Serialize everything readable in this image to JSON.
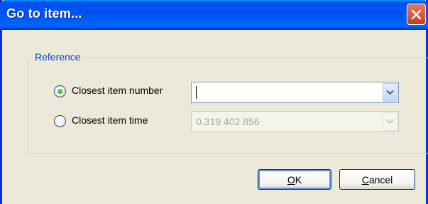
{
  "window": {
    "title": "Go to item..."
  },
  "group": {
    "label": "Reference"
  },
  "options": [
    {
      "label": "Closest item number",
      "selected": true,
      "value": "",
      "enabled": true
    },
    {
      "label": "Closest item time",
      "selected": false,
      "value": "0.319 402 856",
      "enabled": false
    }
  ],
  "buttons": {
    "ok": {
      "mnemonic": "O",
      "rest": "K"
    },
    "cancel": {
      "mnemonic": "C",
      "rest": "ancel"
    }
  },
  "icons": {
    "close": "close-icon",
    "dropdown": "chevron-down-icon"
  },
  "colors": {
    "title_bar": "#0053ee",
    "close": "#e05a3a",
    "dialog_bg": "#ece9d8",
    "legend": "#0046d5",
    "radio_dot": "#34a52f"
  }
}
